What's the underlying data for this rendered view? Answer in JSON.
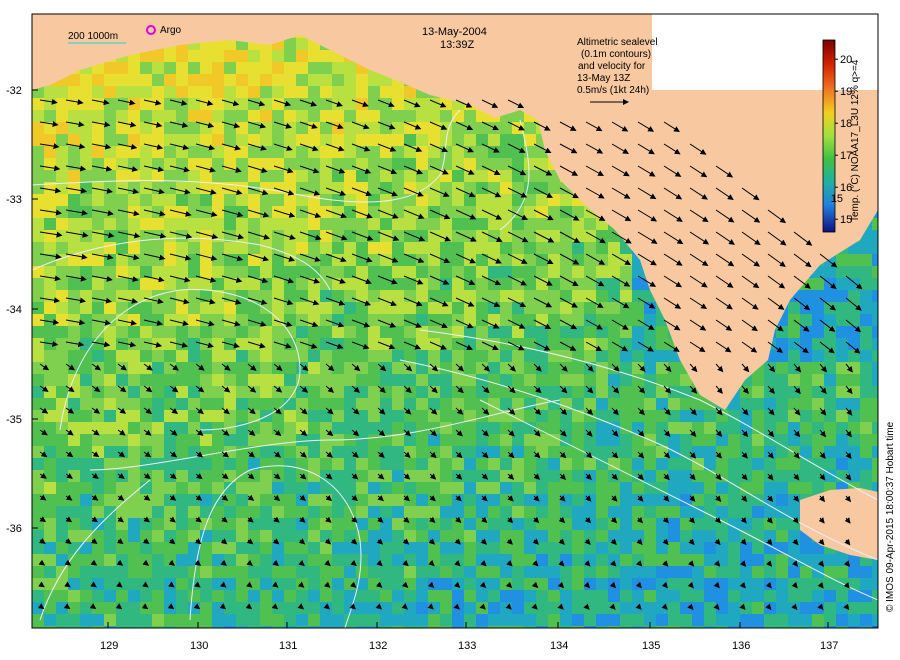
{
  "header": {
    "date": "13-May-2004",
    "time": "13:39Z"
  },
  "legend_note": {
    "lines": [
      "Altimetric sealevel",
      "(0.1m contours)",
      "and velocity for",
      "13-May 13Z",
      "0.5m/s (1kt 24h)"
    ]
  },
  "scale_bar": {
    "label": "200  1000m",
    "line_color": "#5fd6c8"
  },
  "argo": {
    "label": "Argo",
    "marker_color": "#e000e0"
  },
  "axes": {
    "x_ticks": [
      "129",
      "130",
      "131",
      "132",
      "133",
      "134",
      "135",
      "136",
      "137"
    ],
    "y_ticks": [
      "-32",
      "-33",
      "-34",
      "-35",
      "-36"
    ]
  },
  "colorbar": {
    "ticks": [
      "15",
      "16",
      "17",
      "18",
      "19",
      "20"
    ],
    "label": "Temp. (°C) NOAA17_L3U 12% q>=4",
    "range": [
      14.6,
      20.6
    ]
  },
  "credit": "© IMOS 09-Apr-2015 18:00:37 Hobart time",
  "colors": {
    "land": "#f8c8a0",
    "contour": "#e8f0ff",
    "arrow": "#000000"
  }
}
